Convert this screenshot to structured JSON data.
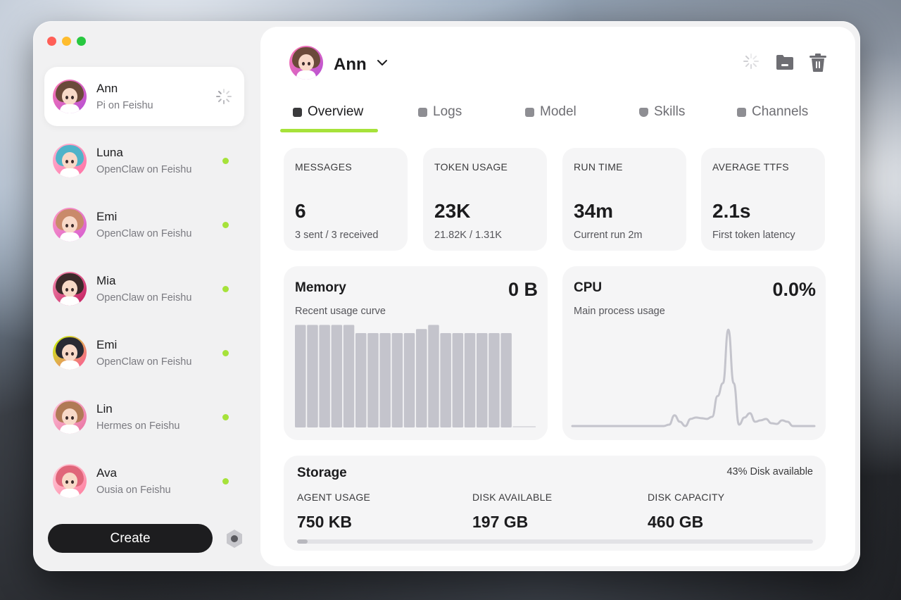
{
  "sidebar": {
    "agents": [
      {
        "name": "Ann",
        "sub": "Pi on Feishu",
        "status": "loading",
        "hair": "#6b4a3a"
      },
      {
        "name": "Luna",
        "sub": "OpenClaw on Feishu",
        "status": "online",
        "hair": "#4fb3c9"
      },
      {
        "name": "Emi",
        "sub": "OpenClaw on Feishu",
        "status": "online",
        "hair": "#c98a6a"
      },
      {
        "name": "Mia",
        "sub": "OpenClaw on Feishu",
        "status": "online",
        "hair": "#3b2a2a"
      },
      {
        "name": "Emi",
        "sub": "OpenClaw on Feishu",
        "status": "online",
        "hair": "#2a2a33"
      },
      {
        "name": "Lin",
        "sub": "Hermes on Feishu",
        "status": "online",
        "hair": "#b07a55"
      },
      {
        "name": "Ava",
        "sub": "Ousia on Feishu",
        "status": "online",
        "hair": "#e0667a"
      }
    ],
    "create_label": "Create"
  },
  "header": {
    "name": "Ann"
  },
  "tabs": [
    {
      "label": "Overview",
      "icon": "bar-chart-icon"
    },
    {
      "label": "Logs",
      "icon": "logs-icon"
    },
    {
      "label": "Model",
      "icon": "code-icon"
    },
    {
      "label": "Skills",
      "icon": "shield-icon"
    },
    {
      "label": "Channels",
      "icon": "radio-icon"
    }
  ],
  "stats": [
    {
      "label": "MESSAGES",
      "value": "6",
      "sub": "3 sent / 3 received"
    },
    {
      "label": "TOKEN USAGE",
      "value": "23K",
      "sub": "21.82K / 1.31K"
    },
    {
      "label": "RUN TIME",
      "value": "34m",
      "sub": "Current run 2m"
    },
    {
      "label": "AVERAGE TTFS",
      "value": "2.1s",
      "sub": "First token latency"
    }
  ],
  "memory": {
    "title": "Memory",
    "value": "0 B",
    "sub": "Recent usage curve",
    "chart_data": {
      "type": "bar",
      "values": [
        100,
        100,
        100,
        100,
        100,
        92,
        92,
        92,
        92,
        92,
        96,
        100,
        92,
        92,
        92,
        92,
        92,
        92
      ],
      "ylim": [
        0,
        103
      ]
    }
  },
  "cpu": {
    "title": "CPU",
    "value": "0.0%",
    "sub": "Main process usage",
    "chart_data": {
      "type": "line",
      "values": [
        0,
        0,
        0,
        0,
        0,
        0,
        0,
        0,
        0,
        0,
        0,
        0,
        0,
        0,
        0,
        0,
        0,
        0,
        2,
        15,
        6,
        0,
        10,
        12,
        11,
        10,
        13,
        42,
        60,
        135,
        60,
        2,
        12,
        18,
        6,
        8,
        10,
        4,
        3,
        8,
        6,
        0,
        0,
        0,
        0,
        0
      ],
      "ylim": [
        0,
        140
      ]
    }
  },
  "storage": {
    "title": "Storage",
    "available_note": "43% Disk available",
    "agent_usage_label": "AGENT USAGE",
    "agent_usage": "750 KB",
    "disk_available_label": "DISK AVAILABLE",
    "disk_available": "197 GB",
    "disk_capacity_label": "DISK CAPACITY",
    "disk_capacity": "460 GB",
    "usage_fraction": 0.02
  }
}
